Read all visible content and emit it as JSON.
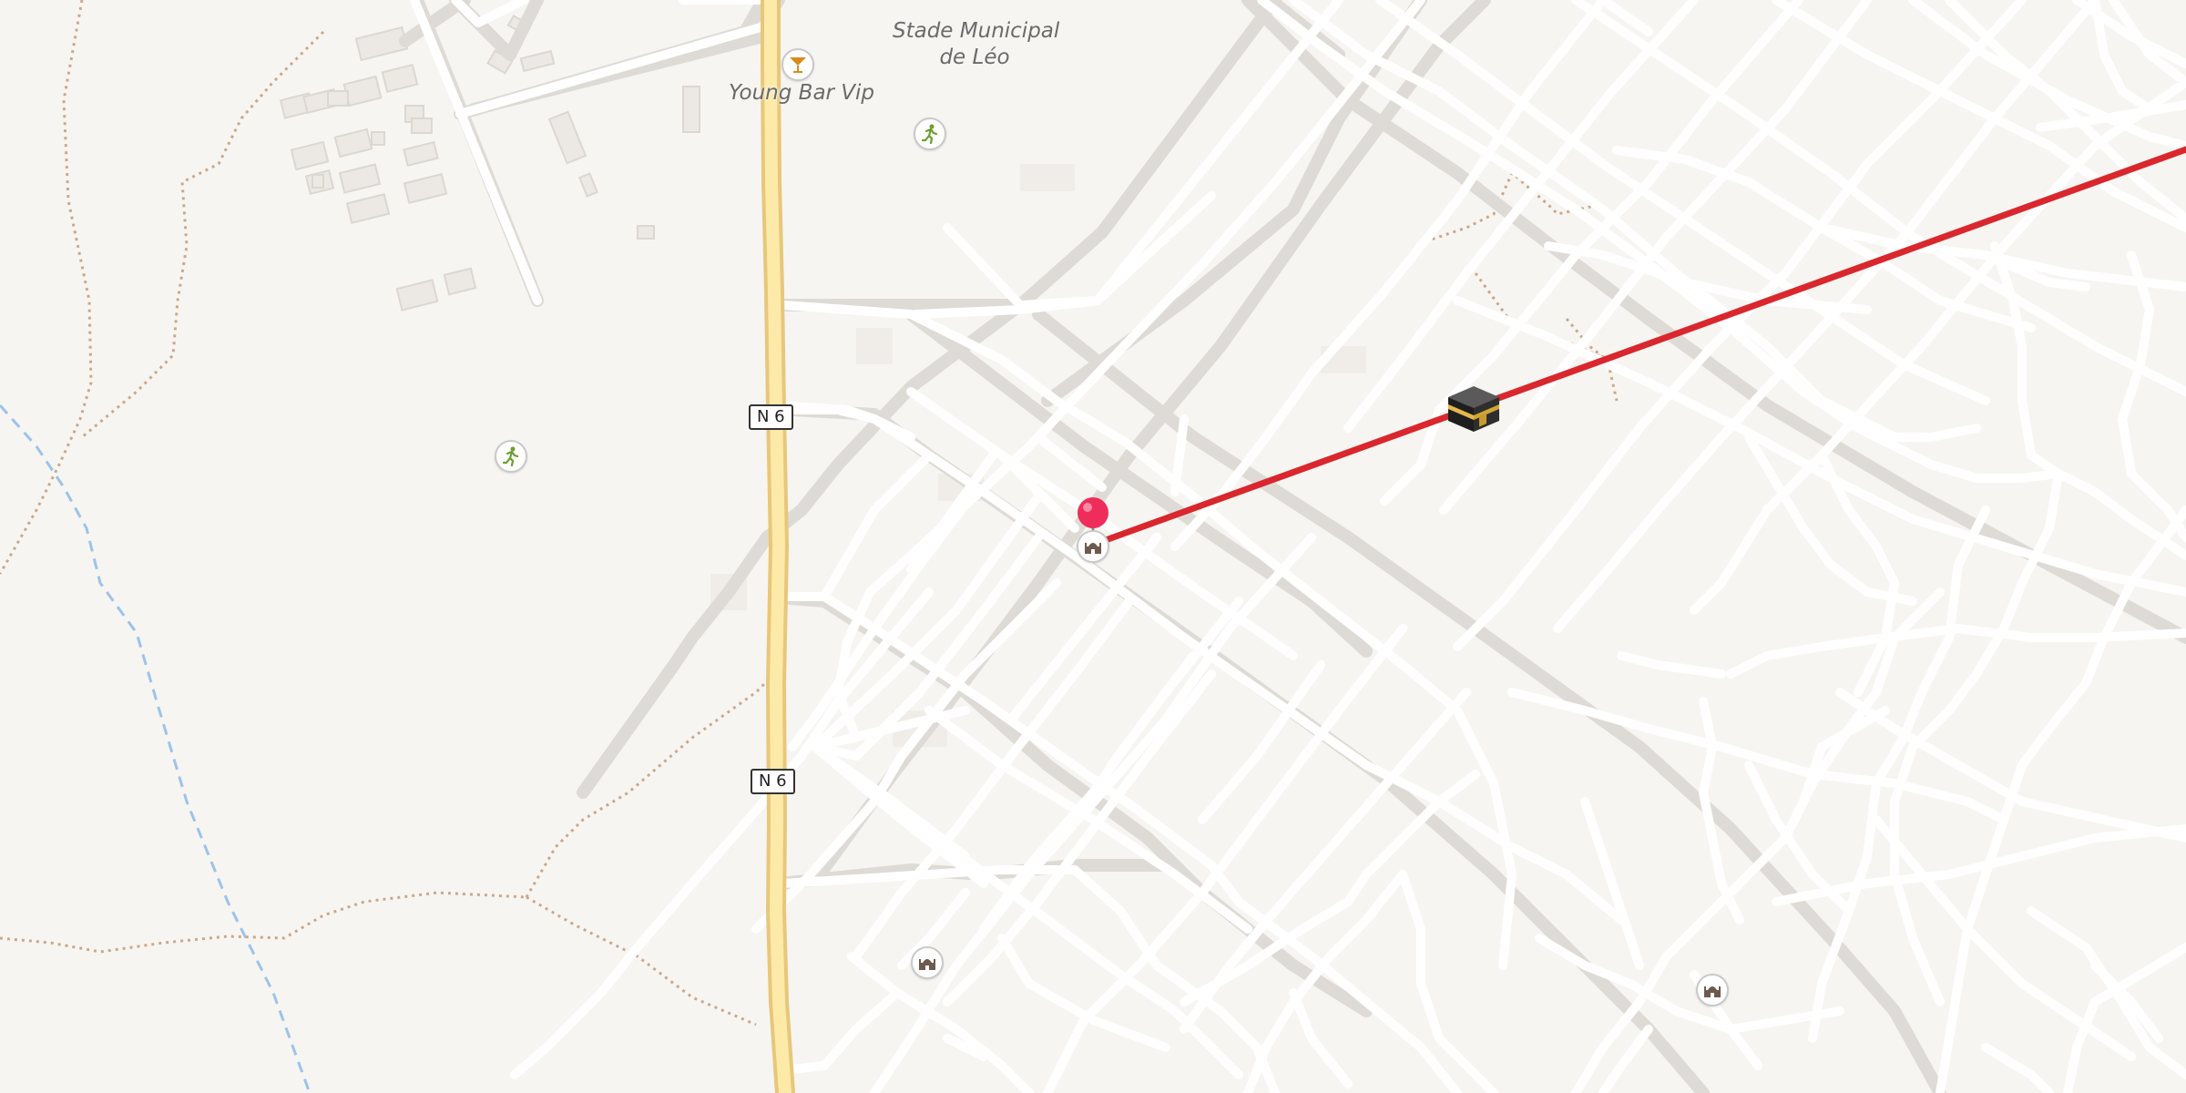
{
  "map": {
    "labels": {
      "stadium": [
        "Stade Municipal",
        "de Léo"
      ],
      "bar": "Young Bar Vip"
    },
    "road_shields": [
      "N 6",
      "N 6"
    ],
    "icons": {
      "sport": "running-person-icon",
      "bar": "cocktail-glass-icon",
      "mosque": "mosque-icon",
      "kaaba": "kaaba-icon",
      "pin": "location-pin-icon"
    },
    "colors": {
      "background": "#f7f5f2",
      "road": "#ffffff",
      "road_casing": "#dedbd6",
      "primary_road": "#fde9a8",
      "primary_road_casing": "#e7c77a",
      "track": "#c9a98a",
      "stream": "#9cc3ea",
      "building": "#ede9e4",
      "qibla_line": "#d9272d",
      "pin": "#ee2d5b",
      "sport_icon": "#6a9e2c",
      "bar_icon": "#d98a1b",
      "mosque_icon": "#6d5a4e"
    }
  }
}
